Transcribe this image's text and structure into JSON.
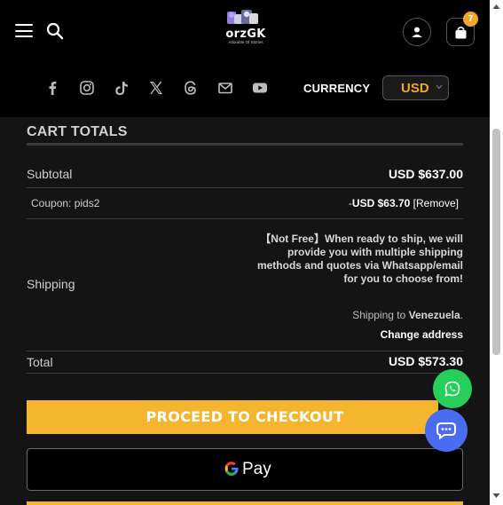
{
  "header": {
    "logo": {
      "name": "orzGK",
      "tagline": "Adorable Of Stories"
    },
    "cart_count": "7",
    "social_icons": [
      "facebook-icon",
      "instagram-icon",
      "tiktok-icon",
      "x-icon",
      "threads-icon",
      "email-icon",
      "youtube-icon"
    ],
    "currency_label": "CURRENCY",
    "currency_value": "USD"
  },
  "cart_totals": {
    "title": "CART TOTALS",
    "subtotal_label": "Subtotal",
    "subtotal_value": "USD $637.00",
    "coupon_label": "Coupon: pids2",
    "coupon_prefix": "-",
    "coupon_value": "USD $63.70",
    "coupon_remove": "[Remove]",
    "shipping_label": "Shipping",
    "shipping_note": "【Not Free】When ready to ship, we will provide you with multiple shipping methods and quotes via Whatsapp/email for you to choose from!",
    "shipping_to_prefix": "Shipping to",
    "shipping_to_country": "Venezuela",
    "shipping_to_suffix": ".",
    "change_address": "Change address",
    "total_label": "Total",
    "total_value": "USD $573.30"
  },
  "actions": {
    "checkout_label": "PROCEED TO CHECKOUT",
    "gpay_label": "Pay"
  },
  "colors": {
    "accent": "#f5b52e",
    "whatsapp": "#25cf5a",
    "chat": "#4a6cf0",
    "background": "#141414"
  }
}
